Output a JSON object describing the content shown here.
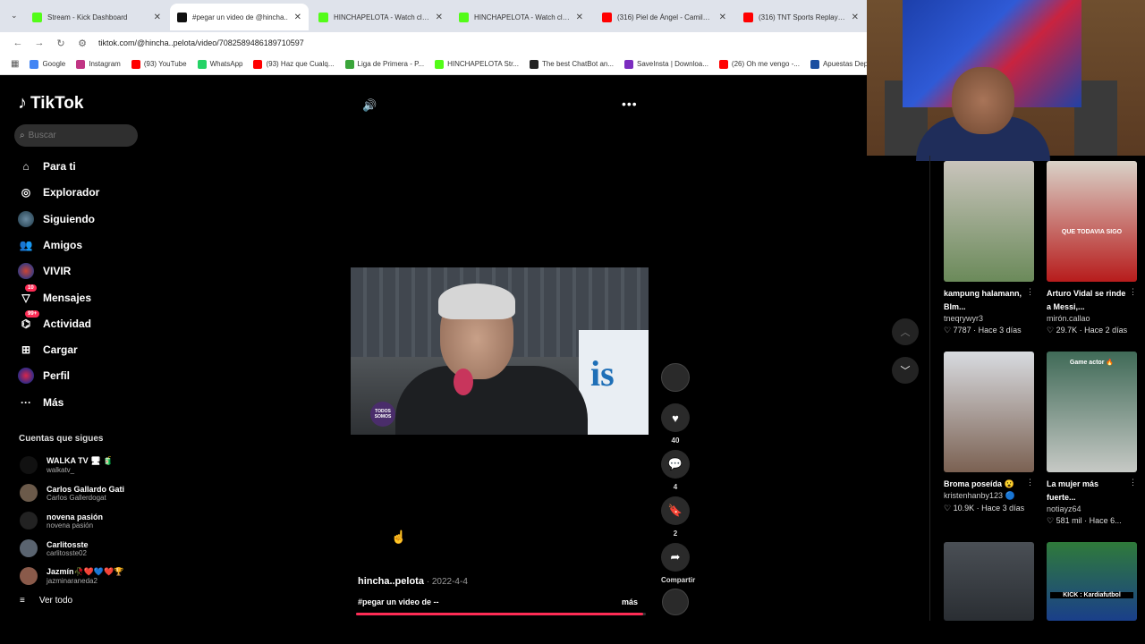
{
  "browser": {
    "tabs": [
      {
        "title": "Stream - Kick Dashboard",
        "icon": "kick-icon",
        "color": "#53fc18",
        "active": false
      },
      {
        "title": "#pegar un video de @hincha..",
        "icon": "tiktok-icon",
        "color": "#111111",
        "active": true
      },
      {
        "title": "HINCHAPELOTA - Watch clips o",
        "icon": "kick-icon",
        "color": "#53fc18",
        "active": false
      },
      {
        "title": "HINCHAPELOTA - Watch clips o",
        "icon": "kick-icon",
        "color": "#53fc18",
        "active": false
      },
      {
        "title": "(316) Piel de Ángel - Camilo Se",
        "icon": "youtube-icon",
        "color": "#ff0000",
        "active": false
      },
      {
        "title": "(316) TNT Sports Replay | Depo",
        "icon": "youtube-icon",
        "color": "#ff0000",
        "active": false
      }
    ],
    "url": "tiktok.com/@hincha..pelota/video/7082589486189710597",
    "bookmarks": [
      {
        "label": "Google",
        "color": "#4285f4"
      },
      {
        "label": "Instagram",
        "color": "#c13584"
      },
      {
        "label": "(93) YouTube",
        "color": "#ff0000"
      },
      {
        "label": "WhatsApp",
        "color": "#25d366"
      },
      {
        "label": "(93) Haz que Cualq...",
        "color": "#ff0000"
      },
      {
        "label": "Liga de Primera - P...",
        "color": "#3aa53a"
      },
      {
        "label": "HINCHAPELOTA Str...",
        "color": "#53fc18"
      },
      {
        "label": "The best ChatBot an...",
        "color": "#222222"
      },
      {
        "label": "SaveInsta | Downloa...",
        "color": "#7b2cbf"
      },
      {
        "label": "(26) Oh me vengo -...",
        "color": "#ff0000"
      },
      {
        "label": "Apuestas Dep",
        "color": "#1a4fa0"
      }
    ]
  },
  "tiktok": {
    "logo": "TikTok",
    "search_placeholder": "Buscar",
    "nav": [
      {
        "label": "Para ti",
        "icon": "home-icon"
      },
      {
        "label": "Explorador",
        "icon": "compass-icon"
      },
      {
        "label": "Siguiendo",
        "icon": "following-avatar-icon"
      },
      {
        "label": "Amigos",
        "icon": "friends-icon"
      },
      {
        "label": "VIVIR",
        "icon": "live-icon"
      },
      {
        "label": "Mensajes",
        "icon": "messages-icon",
        "badge": "10"
      },
      {
        "label": "Actividad",
        "icon": "activity-icon",
        "badge": "99+"
      },
      {
        "label": "Cargar",
        "icon": "upload-icon"
      },
      {
        "label": "Perfil",
        "icon": "profile-avatar-icon"
      },
      {
        "label": "Más",
        "icon": "more-icon"
      }
    ],
    "following_title": "Cuentas que sigues",
    "following": [
      {
        "name": "WALKA TV 🖥 🧃",
        "handle": "walkatv_",
        "color": "#111111"
      },
      {
        "name": "Carlos Gallardo Gati",
        "handle": "Carlos Gallerdogat",
        "color": "#6b5a4a"
      },
      {
        "name": "novena pasión",
        "handle": "novena pasión",
        "color": "#222222"
      },
      {
        "name": "Carlitosste",
        "handle": "carlitosste02",
        "color": "#5a6470"
      },
      {
        "name": "Jazmín🥀❤️💙❤️🏆",
        "handle": "jazminaraneda2",
        "color": "#8a5a4a"
      }
    ],
    "see_all": "Ver todo"
  },
  "video": {
    "volume_icon": "speaker-icon",
    "more_icon": "ellipsis-icon",
    "logo_text": "TODOS SOMOS",
    "sign_text": "is",
    "username": "hincha..pelota",
    "date": "2022-4-4",
    "description": "#pegar un video de --",
    "more_label": "más",
    "progress": 0.99,
    "actions": {
      "likes": "40",
      "comments": "4",
      "saves": "2",
      "share_label": "Compartir"
    }
  },
  "recommendations": [
    {
      "title": "kampung halamann, Blm...",
      "author": "tneqrywyr3",
      "likes": "7787",
      "ago": "Hace 3 días",
      "colors": [
        "#c9c4bc",
        "#6b8a5a"
      ]
    },
    {
      "title": "Arturo Vidal se rinde a Messi,...",
      "author": "mirón.callao",
      "likes": "29.7K",
      "ago": "Hace 2 días",
      "overlay": "QUE TODAVIA SIGO",
      "colors": [
        "#d9d2c8",
        "#b71c1c"
      ]
    },
    {
      "title": "Broma poseída 😮",
      "author": "kristenhanby123 🔵",
      "likes": "10.9K",
      "ago": "Hace 3 días",
      "colors": [
        "#d8dbe0",
        "#7b6152"
      ]
    },
    {
      "title": "La mujer más fuerte...",
      "author": "notiayz64",
      "likes": "581 mil",
      "ago": "Hace 6...",
      "overlay": "Game actor 🔥",
      "colors": [
        "#3f6a57",
        "#c6c9c5"
      ]
    },
    {
      "title": "",
      "author": "",
      "likes": "",
      "ago": "",
      "colors": [
        "#4a4f55",
        "#2a2e33"
      ]
    },
    {
      "title": "",
      "author": "",
      "likes": "",
      "ago": "",
      "overlay": "KICK : Kardiafutbol",
      "colors": [
        "#2f7a3a",
        "#1a3f8a"
      ]
    }
  ]
}
